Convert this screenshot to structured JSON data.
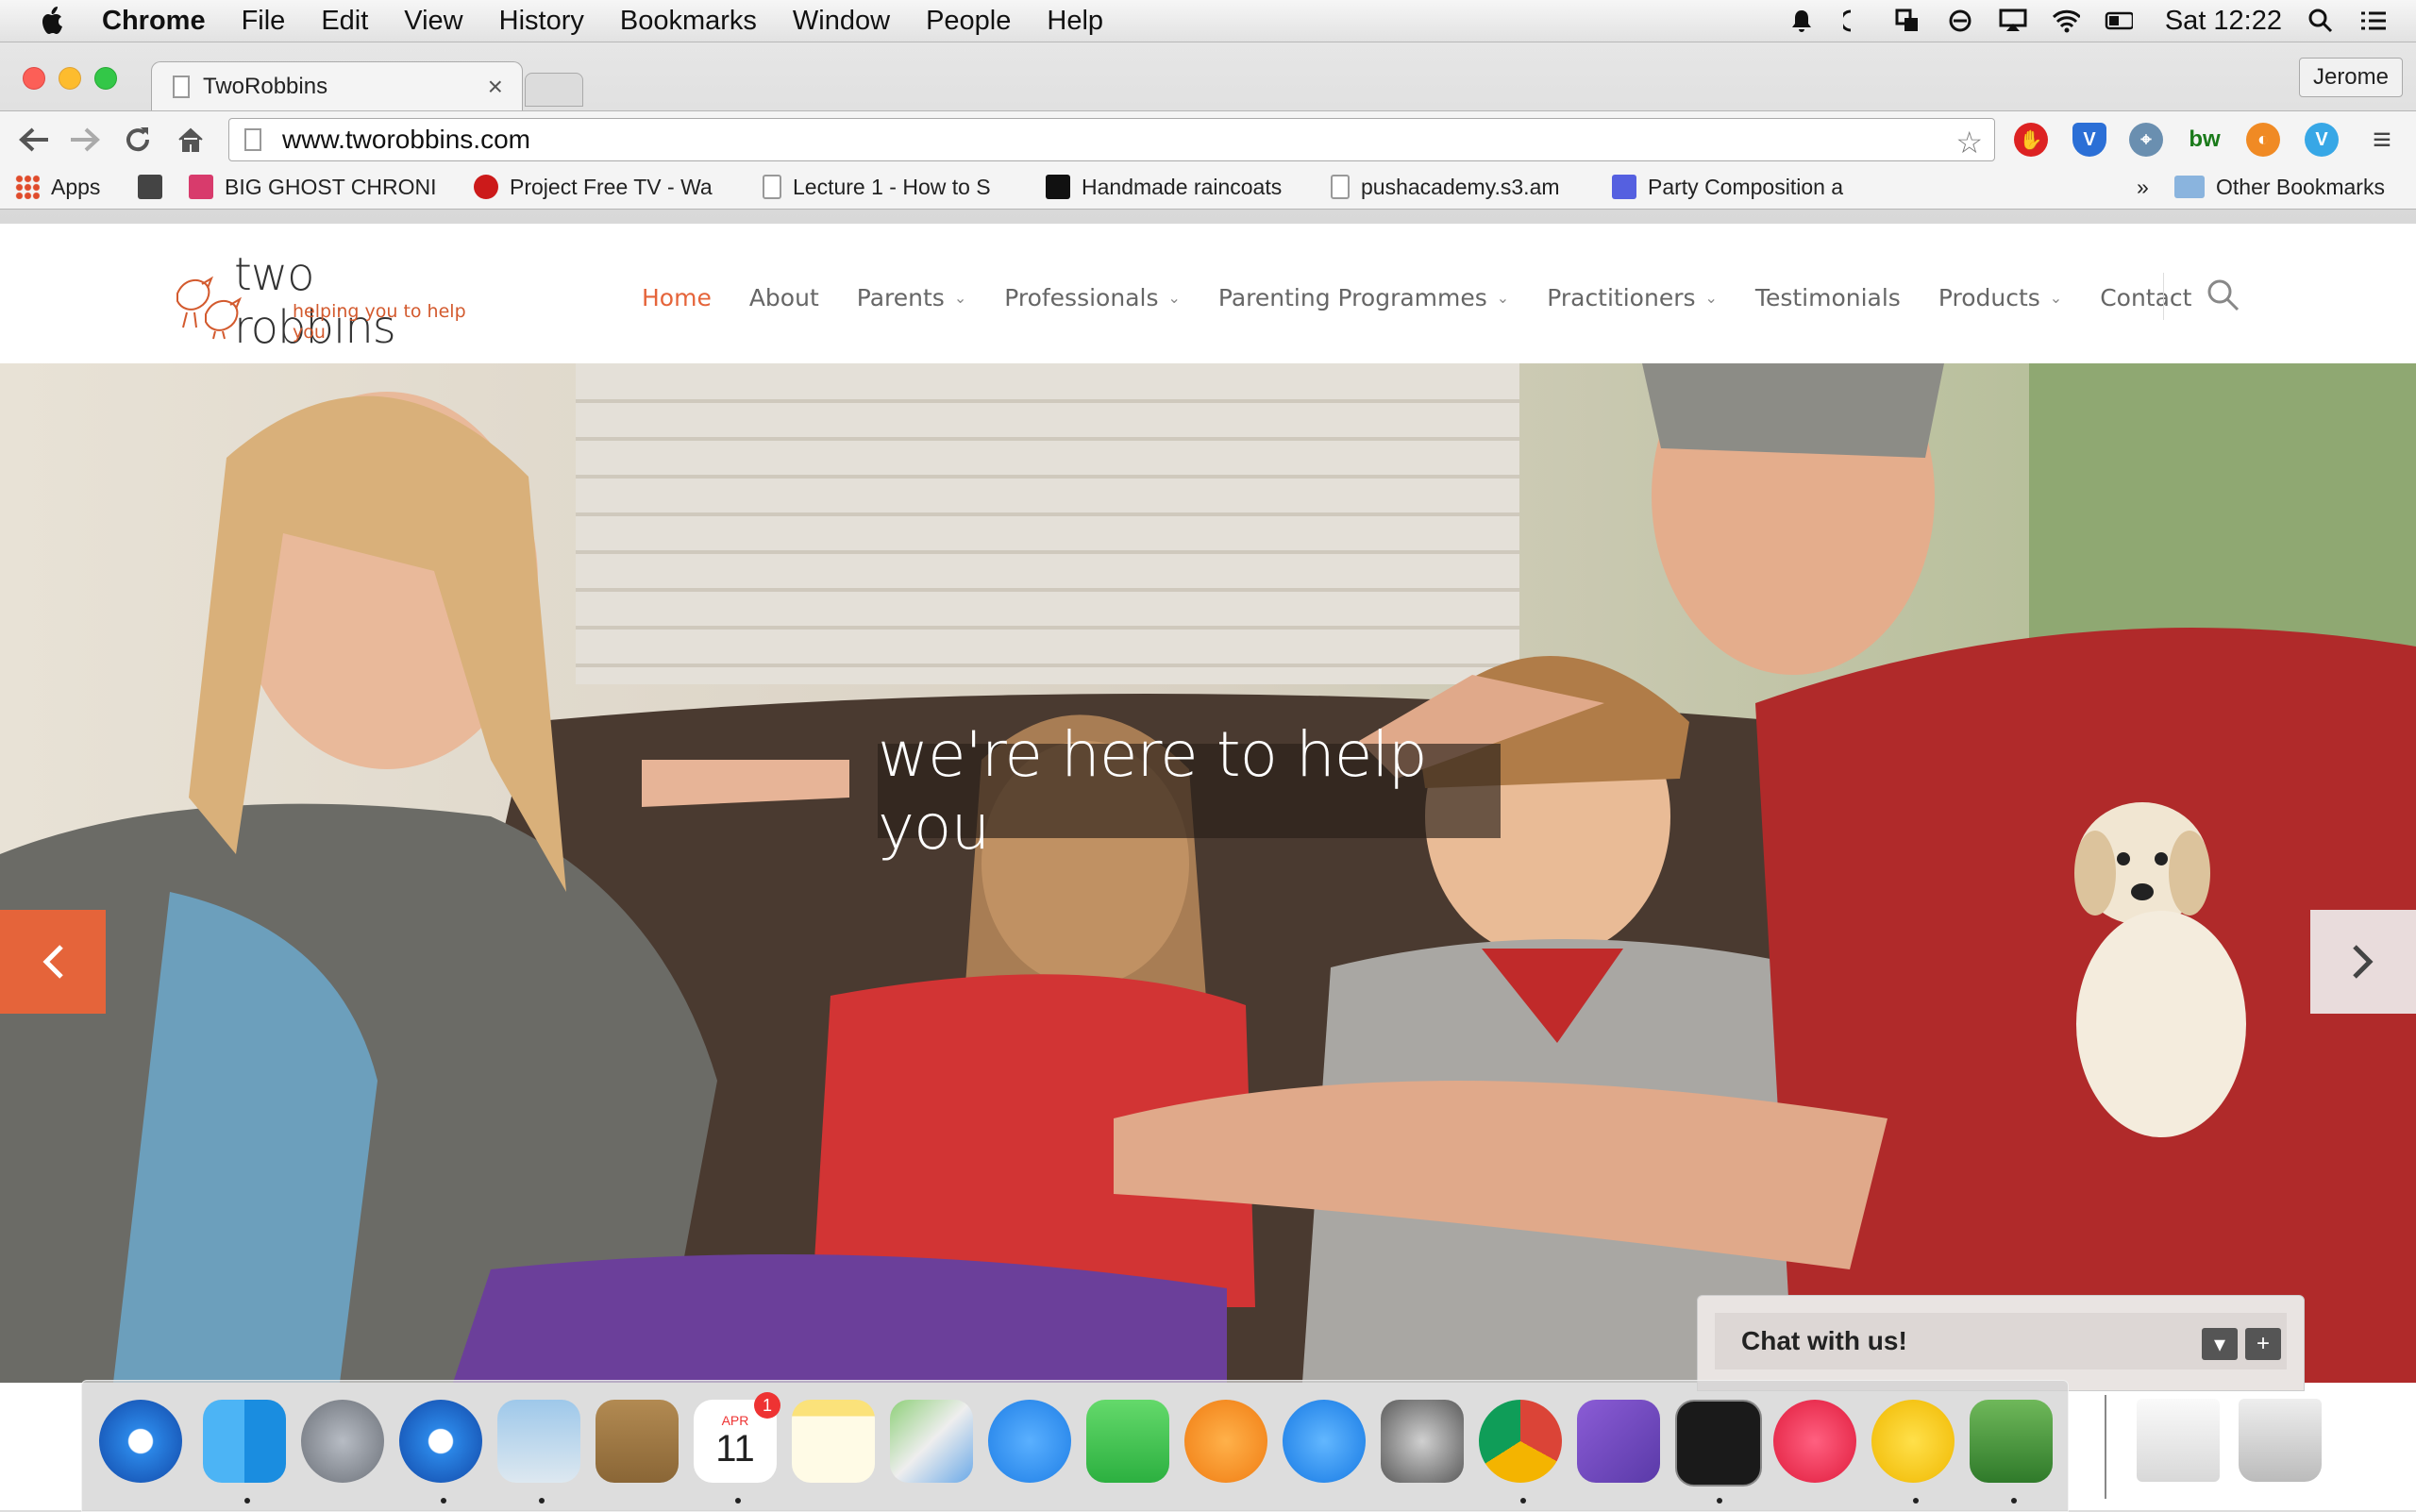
{
  "menubar": {
    "app": "Chrome",
    "items": [
      "File",
      "Edit",
      "View",
      "History",
      "Bookmarks",
      "Window",
      "People",
      "Help"
    ],
    "clock": "Sat 12:22",
    "status_icons": [
      "notification-icon",
      "moon-icon",
      "window-icon",
      "circle-icon",
      "airplay-icon",
      "wifi-icon",
      "battery-icon",
      "spotlight-icon",
      "list-icon"
    ]
  },
  "browser": {
    "tab_title": "TwoRobbins",
    "profile": "Jerome",
    "url": "www.tworobbins.com",
    "extensions": [
      "adblock-icon",
      "shield-icon",
      "satellite-icon",
      "bw-icon",
      "firefox-icon",
      "vimeo-icon"
    ],
    "bookmarks": [
      {
        "label": "Apps",
        "icon": "apps-grid-icon",
        "color": "#e04b2b"
      },
      {
        "label": "",
        "icon": "github-icon",
        "color": "#333333"
      },
      {
        "label": "BIG GHOST CHRONI",
        "icon": "ghost-icon",
        "color": "#d83b6c"
      },
      {
        "label": "Project Free TV - Wa",
        "icon": "virgin-icon",
        "color": "#cc1a1a"
      },
      {
        "label": "Lecture 1 - How to S",
        "icon": "page-icon",
        "color": "#ffffff"
      },
      {
        "label": "Handmade raincoats",
        "icon": "drop-icon",
        "color": "#111111"
      },
      {
        "label": "pushacademy.s3.am",
        "icon": "page-icon",
        "color": "#ffffff"
      },
      {
        "label": "Party Composition a",
        "icon": "g-icon",
        "color": "#5560e0"
      }
    ],
    "overflow": "»",
    "other_bookmarks": "Other Bookmarks"
  },
  "site": {
    "logo_name": "two robbins",
    "logo_tagline": "helping you to help you",
    "nav": [
      {
        "label": "Home",
        "active": true,
        "dropdown": false
      },
      {
        "label": "About",
        "active": false,
        "dropdown": false
      },
      {
        "label": "Parents",
        "active": false,
        "dropdown": true
      },
      {
        "label": "Professionals",
        "active": false,
        "dropdown": true
      },
      {
        "label": "Parenting Programmes",
        "active": false,
        "dropdown": true
      },
      {
        "label": "Practitioners",
        "active": false,
        "dropdown": true
      },
      {
        "label": "Testimonials",
        "active": false,
        "dropdown": false
      },
      {
        "label": "Products",
        "active": false,
        "dropdown": true
      },
      {
        "label": "Contact",
        "active": false,
        "dropdown": false
      }
    ],
    "accent_color": "#e5643a",
    "hero_caption": "we're here to help you",
    "chat_label": "Chat with us!",
    "calendar_month": "APR",
    "calendar_day": "11",
    "calendar_badge": "1"
  },
  "dock": [
    "safari-icon",
    "finder-icon",
    "launchpad-icon",
    "safari-icon",
    "preview-icon",
    "contacts-icon",
    "calendar-icon",
    "notes-icon",
    "maps-icon",
    "messages-icon",
    "facetime-icon",
    "ibooks-icon",
    "appstore-icon",
    "system-preferences-icon",
    "chrome-icon",
    "dash-icon",
    "terminal-icon",
    "itunes-icon",
    "cyberduck-icon",
    "vim-icon",
    "archive-icon",
    "trash-icon"
  ]
}
